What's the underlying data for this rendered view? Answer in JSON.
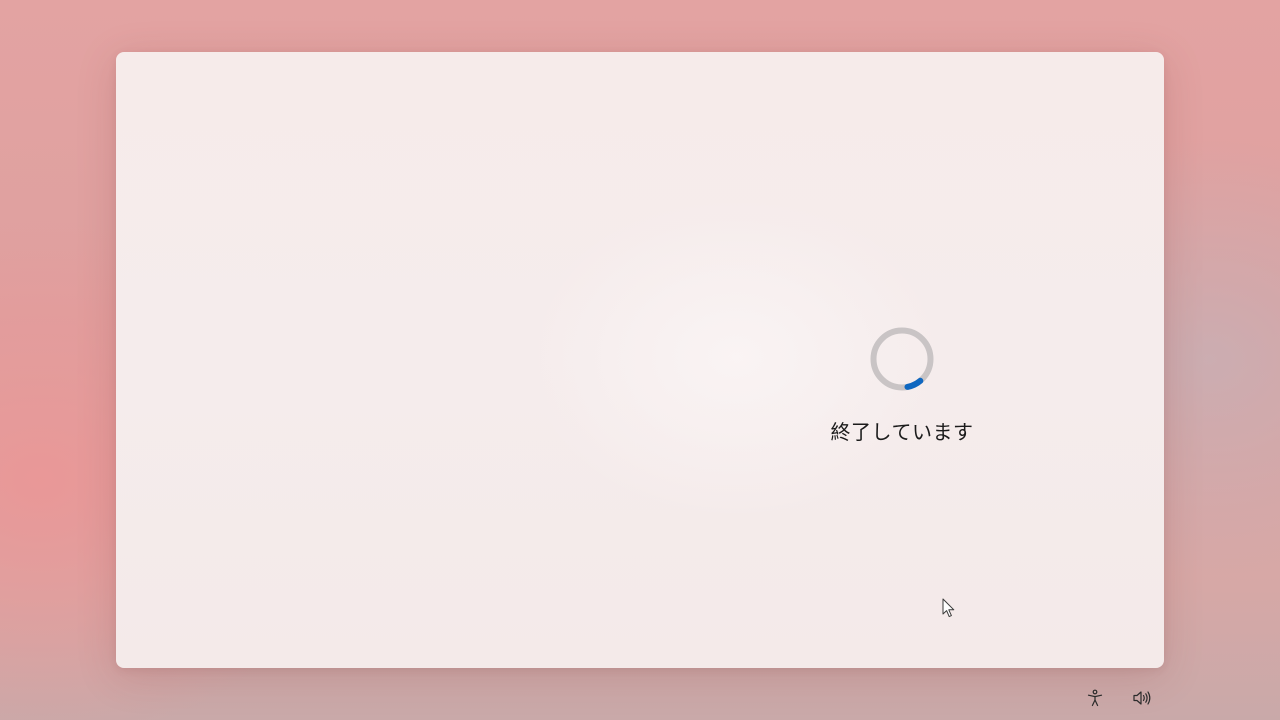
{
  "status": {
    "message": "終了しています"
  },
  "spinner": {
    "track_color": "#c9c4c5",
    "accent_color": "#0f67c0"
  },
  "tray": {
    "accessibility_icon": "accessibility-icon",
    "volume_icon": "volume-icon"
  }
}
